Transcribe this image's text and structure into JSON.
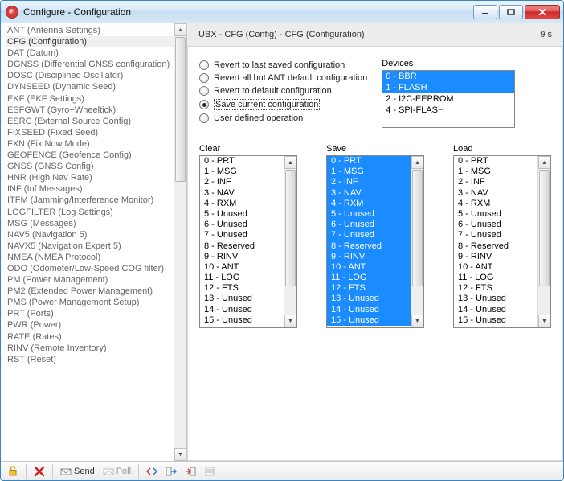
{
  "window": {
    "title": "Configure - Configuration"
  },
  "tree": {
    "selected_index": 1,
    "items": [
      "ANT (Antenna Settings)",
      "CFG (Configuration)",
      "DAT (Datum)",
      "DGNSS (Differential GNSS configuration)",
      "DOSC (Disciplined Oscillator)",
      "DYNSEED (Dynamic Seed)",
      "EKF (EKF Settings)",
      "ESFGWT (Gyro+Wheeltick)",
      "ESRC (External Source Config)",
      "FIXSEED (Fixed Seed)",
      "FXN (Fix Now Mode)",
      "GEOFENCE (Geofence Config)",
      "GNSS (GNSS Config)",
      "HNR (High Nav Rate)",
      "INF (Inf Messages)",
      "ITFM (Jamming/Interference Monitor)",
      "LOGFILTER (Log Settings)",
      "MSG (Messages)",
      "NAV5 (Navigation 5)",
      "NAVX5 (Navigation Expert 5)",
      "NMEA (NMEA Protocol)",
      "ODO (Odometer/Low-Speed COG filter)",
      "PM (Power Management)",
      "PM2 (Extended Power Management)",
      "PMS (Power Management Setup)",
      "PRT (Ports)",
      "PWR (Power)",
      "RATE (Rates)",
      "RINV (Remote Inventory)",
      "RST (Reset)"
    ]
  },
  "panel": {
    "path": "UBX - CFG (Config) - CFG (Configuration)",
    "elapsed": "9 s",
    "radios": {
      "selected": 3,
      "options": [
        "Revert to last saved configuration",
        "Revert all but ANT default configuration",
        "Revert to default configuration",
        "Save current configuration",
        "User defined operation"
      ]
    },
    "devices": {
      "label": "Devices",
      "selected": [
        0,
        1
      ],
      "items": [
        "0 - BBR",
        "1 - FLASH",
        "2 - I2C-EEPROM",
        "4 - SPI-FLASH"
      ]
    },
    "lists": {
      "clear": {
        "label": "Clear",
        "selected": [],
        "items": [
          "0 - PRT",
          "1 - MSG",
          "2 - INF",
          "3 - NAV",
          "4 - RXM",
          "5 - Unused",
          "6 - Unused",
          "7 - Unused",
          "8 - Reserved",
          "9 - RINV",
          "10 - ANT",
          "11 - LOG",
          "12 - FTS",
          "13 - Unused",
          "14 - Unused",
          "15 - Unused"
        ]
      },
      "save": {
        "label": "Save",
        "selected": [
          0,
          1,
          2,
          3,
          4,
          5,
          6,
          7,
          8,
          9,
          10,
          11,
          12,
          13,
          14,
          15
        ],
        "items": [
          "0 - PRT",
          "1 - MSG",
          "2 - INF",
          "3 - NAV",
          "4 - RXM",
          "5 - Unused",
          "6 - Unused",
          "7 - Unused",
          "8 - Reserved",
          "9 - RINV",
          "10 - ANT",
          "11 - LOG",
          "12 - FTS",
          "13 - Unused",
          "14 - Unused",
          "15 - Unused"
        ]
      },
      "load": {
        "label": "Load",
        "selected": [],
        "items": [
          "0 - PRT",
          "1 - MSG",
          "2 - INF",
          "3 - NAV",
          "4 - RXM",
          "5 - Unused",
          "6 - Unused",
          "7 - Unused",
          "8 - Reserved",
          "9 - RINV",
          "10 - ANT",
          "11 - LOG",
          "12 - FTS",
          "13 - Unused",
          "14 - Unused",
          "15 - Unused"
        ]
      }
    }
  },
  "toolbar": {
    "send": "Send",
    "poll": "Poll"
  }
}
